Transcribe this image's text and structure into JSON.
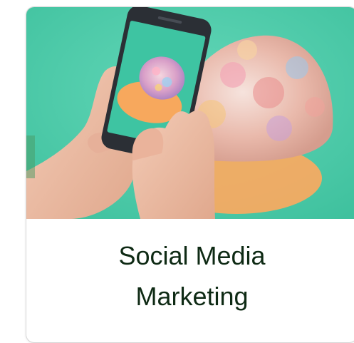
{
  "card": {
    "title_line1": "Social Media",
    "title_line2": "Marketing",
    "image_icon": "photo-phone-cap-icon"
  },
  "colors": {
    "background": "#ffffff",
    "card_border": "#d6d6d6",
    "title_text": "#0e2a14",
    "image_backdrop": "#4fcfae",
    "cap_brim": "#f8a85a",
    "phone_body": "#2b2f35"
  }
}
